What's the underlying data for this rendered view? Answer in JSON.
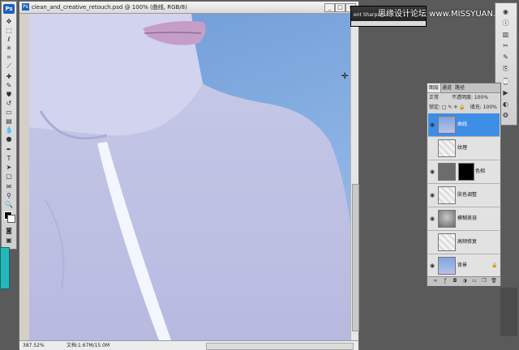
{
  "app": {
    "logo": "Ps"
  },
  "document": {
    "title": "clean_and_creative_retouch.psd @ 100% (曲线, RGB/8)",
    "buttons": {
      "minimize": "_",
      "maximize": "□",
      "close": "×"
    },
    "status": {
      "zoom": "387.52%",
      "size": "文档:1.67M/15.0M"
    }
  },
  "filter_bar": {
    "label": "ent Sharpness"
  },
  "watermark": {
    "text": "思缘设计论坛 www.MISSYUAN.COM"
  },
  "layers_panel": {
    "tabs": [
      "图层",
      "通道",
      "路径"
    ],
    "blend_mode": "正常",
    "opacity": "不透明度: 100%",
    "lock": "锁定: □ ✎ ✛ 🔒",
    "fill": "填充: 100%",
    "layers": [
      {
        "name": "曲线",
        "selected": true
      },
      {
        "name": "纹理",
        "selected": false
      },
      {
        "name": "色相",
        "selected": false
      },
      {
        "name": "肤色调整",
        "selected": false
      },
      {
        "name": "模糊美容",
        "selected": false
      },
      {
        "name": "高频修复",
        "selected": false
      },
      {
        "name": "背景",
        "selected": false
      }
    ]
  },
  "colors": {
    "selected_layer": "#3e8ee6",
    "canvas_tint": "#8cb3e4"
  }
}
